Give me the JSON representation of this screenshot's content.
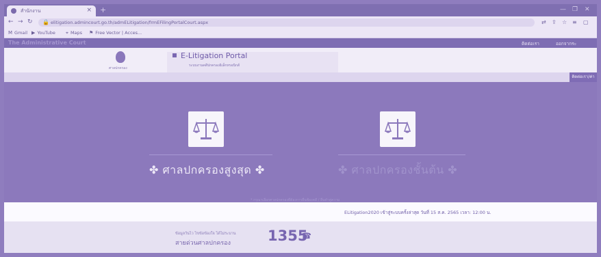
{
  "browser": {
    "tab_title": "สำนักงาน",
    "tab_close": "×",
    "new_tab": "+",
    "url": "elitigation.admincourt.go.th/admELitigation/frmEFilingPortalCourt.aspx",
    "bookmarks": [
      {
        "icon": "gmail-icon",
        "label": "Gmail"
      },
      {
        "icon": "youtube-icon",
        "label": "YouTube"
      },
      {
        "icon": "maps-icon",
        "label": "Maps"
      },
      {
        "icon": "bookmark-icon",
        "label": "Free Vector | Acces..."
      }
    ]
  },
  "site": {
    "brand": "The Administrative Court",
    "contact": "ติดต่อเรา",
    "login": "ออกจากระ"
  },
  "portal": {
    "logo_caption": "ศาลปกครอง",
    "title": "E-Litigation Portal",
    "subtitle": "ระบบงานคดีปกครองอิเล็กทรอนิกส์",
    "contact_tab": "ติดต่อเรา/ค่า"
  },
  "courts": [
    {
      "name": "✤ ศาลปกครองสูงสุด ✤"
    },
    {
      "name": "✤ ศาลปกครองชั้นต้น ✤"
    }
  ],
  "footnote": "* กรุณาเลือกศาลปกครองที่ต้องการยื่นฟ้องคดี / ยื่นคำคู่ความ",
  "notice": "ELitigation2020 เข้าสู่ระบบครั้งล่าสุด วันที่ 15 ส.ค. 2565 เวลา: 12:00 น.",
  "footer": {
    "small": "ข้อมูลวันไว ไขข้อข้องใจ ได้ไม่ระบาน",
    "main": "สายด่วนศาลปกครอง",
    "number": "1355",
    "phone_icon": "☎"
  },
  "colors": {
    "overlay": "#8c79bc",
    "accent": "#7765b0"
  }
}
